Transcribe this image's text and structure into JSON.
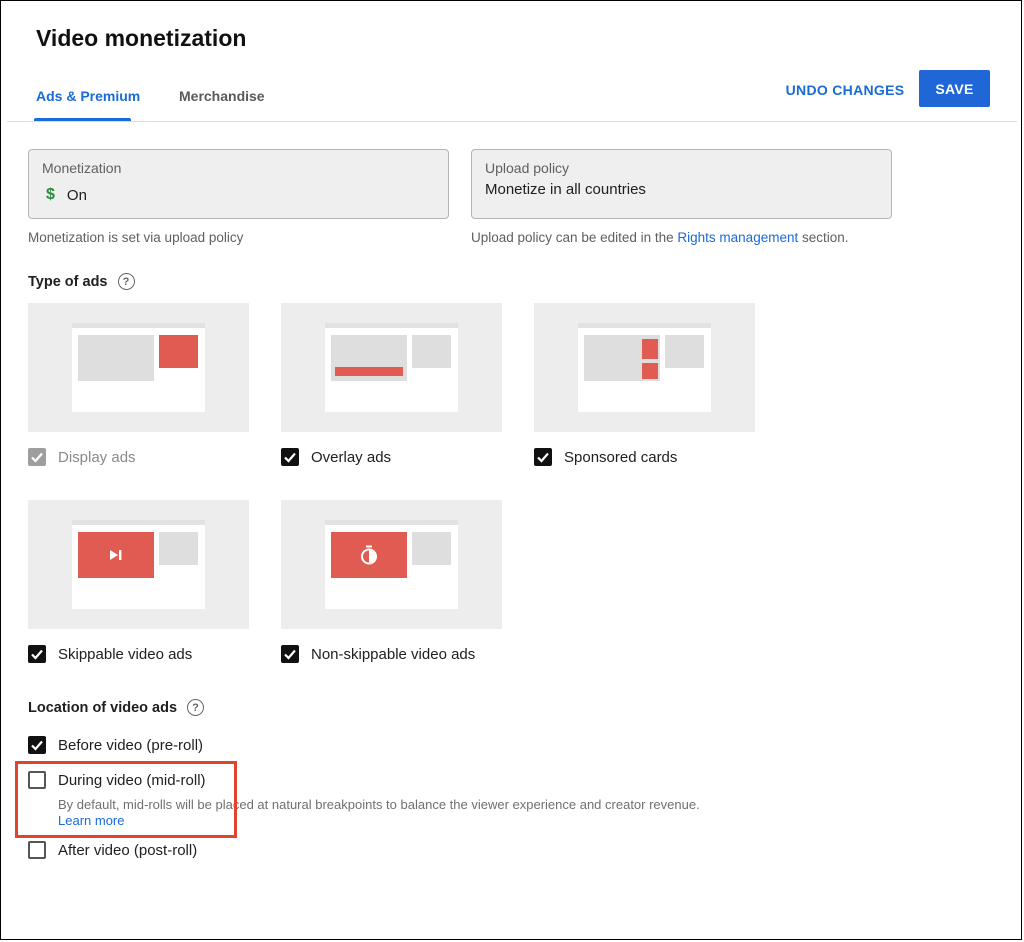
{
  "page": {
    "title": "Video monetization",
    "tabs": [
      {
        "label": "Ads & Premium",
        "active": true
      },
      {
        "label": "Merchandise",
        "active": false
      }
    ],
    "actions": {
      "undo_label": "UNDO CHANGES",
      "save_label": "SAVE"
    }
  },
  "monetization": {
    "label": "Monetization",
    "icon": "dollar-icon",
    "value": "On",
    "helper": "Monetization is set via upload policy"
  },
  "upload_policy": {
    "label": "Upload policy",
    "value": "Monetize in all countries",
    "helper_prefix": "Upload policy can be edited in the",
    "helper_link": "Rights management",
    "helper_suffix": "section."
  },
  "type_of_ads": {
    "title": "Type of ads",
    "items": [
      {
        "label": "Display ads",
        "checked": true,
        "disabled": true
      },
      {
        "label": "Overlay ads",
        "checked": true,
        "disabled": false
      },
      {
        "label": "Sponsored cards",
        "checked": true,
        "disabled": false
      },
      {
        "label": "Skippable video ads",
        "checked": true,
        "disabled": false
      },
      {
        "label": "Non-skippable video ads",
        "checked": true,
        "disabled": false
      }
    ]
  },
  "location_of_video_ads": {
    "title": "Location of video ads",
    "items": [
      {
        "label": "Before video (pre-roll)",
        "checked": true
      },
      {
        "label": "During video (mid-roll)",
        "checked": false
      },
      {
        "label": "After video (post-roll)",
        "checked": false
      }
    ],
    "midroll_description": "By default, mid-rolls will be placed at natural breakpoints to balance the viewer experience and creator revenue.",
    "midroll_link": "Learn more"
  },
  "colors": {
    "accent": "#1a6ad9",
    "ad_red": "#e05b51",
    "highlight": "#e0442f"
  }
}
